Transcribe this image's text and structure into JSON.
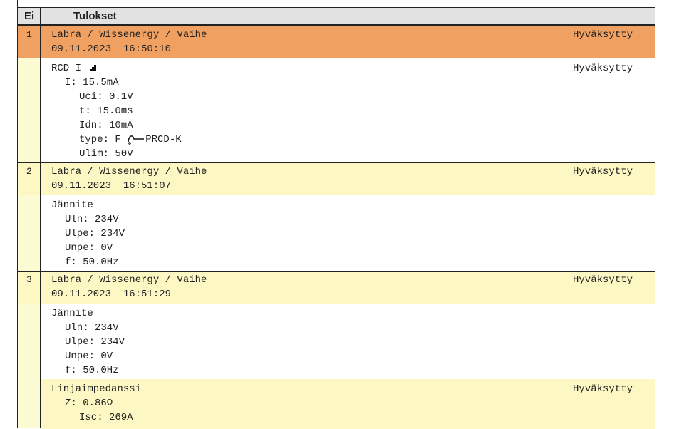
{
  "header": {
    "col_no": "Ei",
    "col_results": "Tulokset"
  },
  "entries": [
    {
      "no": "1",
      "path": "Labra / Wissenergy / Vaihe",
      "datetime": "09.11.2023  16:50:10",
      "status": "Hyväksytty",
      "colors": {
        "band": "#f0a060"
      }
    },
    {
      "no": "2",
      "path": "Labra / Wissenergy / Vaihe",
      "datetime": "09.11.2023  16:51:07",
      "status": "Hyväksytty",
      "colors": {
        "band": "#fdf8c3"
      }
    },
    {
      "no": "3",
      "path": "Labra / Wissenergy / Vaihe",
      "datetime": "09.11.2023  16:51:29",
      "status": "Hyväksytty",
      "colors": {
        "band": "#fdf8c3"
      }
    }
  ],
  "rcd": {
    "title": "RCD I",
    "status": "Hyväksytty",
    "i": "I: 15.5mA",
    "uci": "Uci: 0.1V",
    "t": "t: 15.0ms",
    "idn": "Idn: 10mA",
    "type_prefix": "type: F",
    "type_suffix": "PRCD-K",
    "ulim": "Ulim: 50V",
    "icons": [
      "ramp-icon",
      "rcd-symbol-icon"
    ]
  },
  "voltage2": {
    "title": "Jännite",
    "uln": "Uln: 234V",
    "ulpe": "Ulpe: 234V",
    "unpe": "Unpe: 0V",
    "f": "f: 50.0Hz"
  },
  "voltage3": {
    "title": "Jännite",
    "uln": "Uln: 234V",
    "ulpe": "Ulpe: 234V",
    "unpe": "Unpe: 0V",
    "f": "f: 50.0Hz"
  },
  "impedance": {
    "title": "Linjaimpedanssi",
    "status": "Hyväksytty",
    "z": "Z: 0.86Ω",
    "isc": "Isc: 269A"
  }
}
